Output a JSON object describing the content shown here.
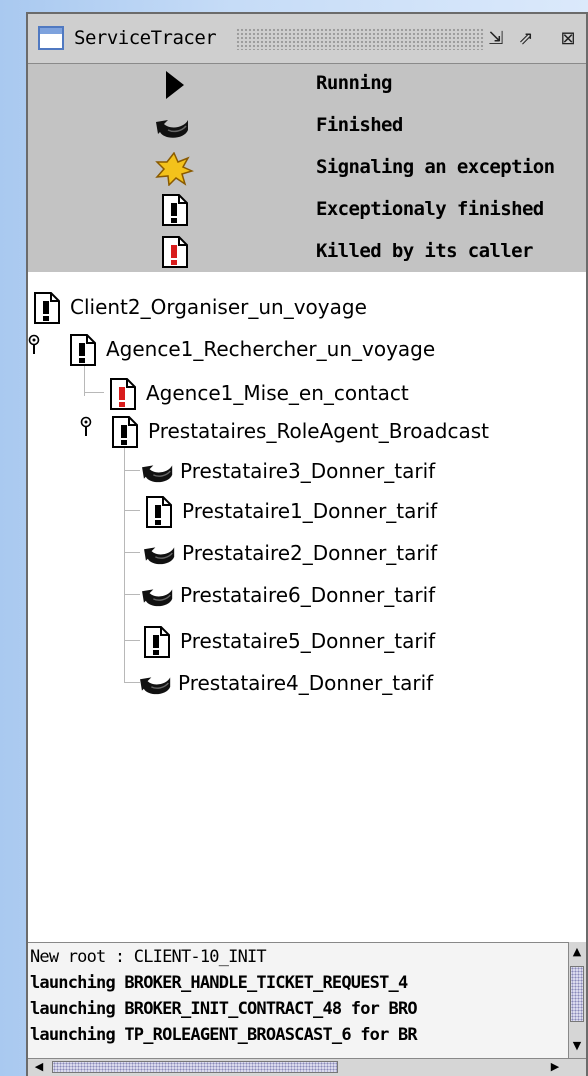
{
  "window": {
    "title": "ServiceTracer"
  },
  "legend": [
    {
      "icon": "running-icon",
      "label": "Running"
    },
    {
      "icon": "finished-icon",
      "label": "Finished"
    },
    {
      "icon": "signaling-exception-icon",
      "label": "Signaling an exception"
    },
    {
      "icon": "exceptionally-finished-icon",
      "label": "Exceptionaly finished"
    },
    {
      "icon": "killed-icon",
      "label": "Killed by its caller"
    }
  ],
  "tree": {
    "root": {
      "label": "Client2_Organiser_un_voyage",
      "status": "exceptionally-finished"
    },
    "agence_search": {
      "label": "Agence1_Rechercher_un_voyage",
      "status": "exceptionally-finished"
    },
    "agence_contact": {
      "label": "Agence1_Mise_en_contact",
      "status": "killed"
    },
    "broadcast": {
      "label": "Prestataires_RoleAgent_Broadcast",
      "status": "exceptionally-finished"
    },
    "children": [
      {
        "label": "Prestataire3_Donner_tarif",
        "status": "finished"
      },
      {
        "label": "Prestataire1_Donner_tarif",
        "status": "exceptionally-finished"
      },
      {
        "label": "Prestataire2_Donner_tarif",
        "status": "finished"
      },
      {
        "label": "Prestataire6_Donner_tarif",
        "status": "finished"
      },
      {
        "label": "Prestataire5_Donner_tarif",
        "status": "exceptionally-finished"
      },
      {
        "label": "Prestataire4_Donner_tarif",
        "status": "finished"
      }
    ]
  },
  "log": {
    "lines": [
      "New root : CLIENT-10_INIT",
      "launching BROKER_HANDLE_TICKET_REQUEST_4",
      "launching BROKER_INIT_CONTRACT_48 for BRO",
      "launching TP_ROLEAGENT_BROASCAST_6 for BR"
    ]
  },
  "colors": {
    "legend_bg": "#c3c3c3",
    "tree_bg": "#ffffff",
    "exception_red": "#d81c1c",
    "signal_yellow": "#f3c21b"
  }
}
